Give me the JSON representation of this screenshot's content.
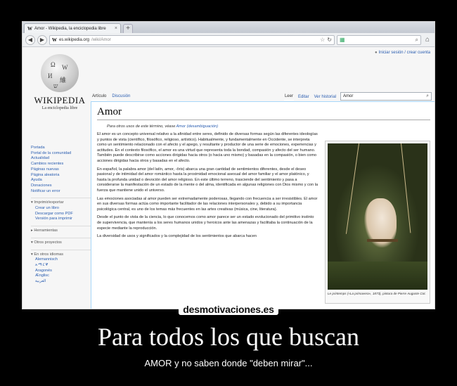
{
  "browser": {
    "tab_title": "Amor - Wikipedia, la enciclopedia libre",
    "tab_favicon": "W",
    "new_tab": "+",
    "url_domain": "es.wikipedia.org",
    "url_path": "/wiki/Amor",
    "search_engine_text": ""
  },
  "wiki": {
    "login": "Iniciar sesión / crear cuenta",
    "wordmark": "WIKIPEDIA",
    "tagline": "La enciclopedia libre",
    "tabs_left": [
      "Artículo",
      "Discusión"
    ],
    "tabs_right": [
      "Leer",
      "Editar",
      "Ver historial"
    ],
    "search_value": "Amor",
    "sidebar": {
      "nav": [
        "Portada",
        "Portal de la comunidad",
        "Actualidad",
        "Cambios recientes",
        "Páginas nuevas",
        "Página aleatoria",
        "Ayuda",
        "Donaciones",
        "Notificar un error"
      ],
      "print_section": "Imprimir/exportar",
      "print_items": [
        "Crear un libro",
        "Descargar como PDF",
        "Versión para imprimir"
      ],
      "tools_section": "Herramientas",
      "other_section": "Otros proyectos",
      "lang_section": "En otros idiomas",
      "lang_items": [
        "Alemannisch",
        "Aragonés",
        "Ænglisc",
        "العربية"
      ],
      "lang_glyphs": "አማርኛ"
    },
    "article": {
      "title": "Amor",
      "hatnote_pre": "Para otros usos de este término, véase ",
      "hatnote_link": "Amor (desambiguación)",
      "p1": "El amor es un concepto universal relativo a la afinidad entre seres, definido de diversas formas según las diferentes ideologías y puntos de vista (científico, filosófico, religioso, artístico). Habitualmente, y fundamentalmente en Occidente, se interpreta como un sentimiento relacionado con el afecto y el apego, y resultante y productor de una serie de emociones, experiencias y actitudes. En el contexto filosófico, el amor es una virtud que representa toda la bondad, compasión y afecto del ser humano. También puede describirse como acciones dirigidas hacia otros (o hacia uno mismo) y basadas en la compasión, o bien como acciones dirigidas hacia otros y basadas en el afecto.",
      "p2": "En español, la palabra amor (del latín, amor, -ōris) abarca una gran cantidad de sentimientos diferentes, desde el deseo pasional y de intimidad del amor romántico hasta la proximidad emocional asexual del amor familiar y el amor platónico, y hasta la profunda unidad o devoción del amor religioso. En este último terreno, trasciende del sentimiento y pasa a considerarse la manifestación de un estado de la mente o del alma, identificada en algunas religiones con Dios mismo y con la fuerza que mantiene unido el universo.",
      "p3": "Las emociones asociadas al amor pueden ser extremadamente poderosas, llegando con frecuencia a ser irresistibles. El amor en sus diversas formas actúa como importante facilitador de las relaciones interpersonales y, debido a su importancia psicológica central, es uno de los temas más frecuentes en las artes creativas (música, cine, literatura).",
      "p4": "Desde el punto de vista de la ciencia, lo que conocemos como amor parece ser un estado evolucionado del primitivo instinto de supervivencia, que mantenía a los seres humanos unidos y heroicos ante las amenazas y facilitaba la continuación de la especie mediante la reproducción.",
      "p5": "La diversidad de usos y significados y la complejidad de los sentimientos que abarca hacen",
      "caption": "Le printemps («La primavera», 1873), pintura de Pierre Auguste Cot."
    }
  },
  "poster": {
    "watermark": "desmotivaciones.es",
    "headline": "Para todos los que buscan",
    "subline": "AMOR y no saben donde \"deben mirar\"..."
  }
}
